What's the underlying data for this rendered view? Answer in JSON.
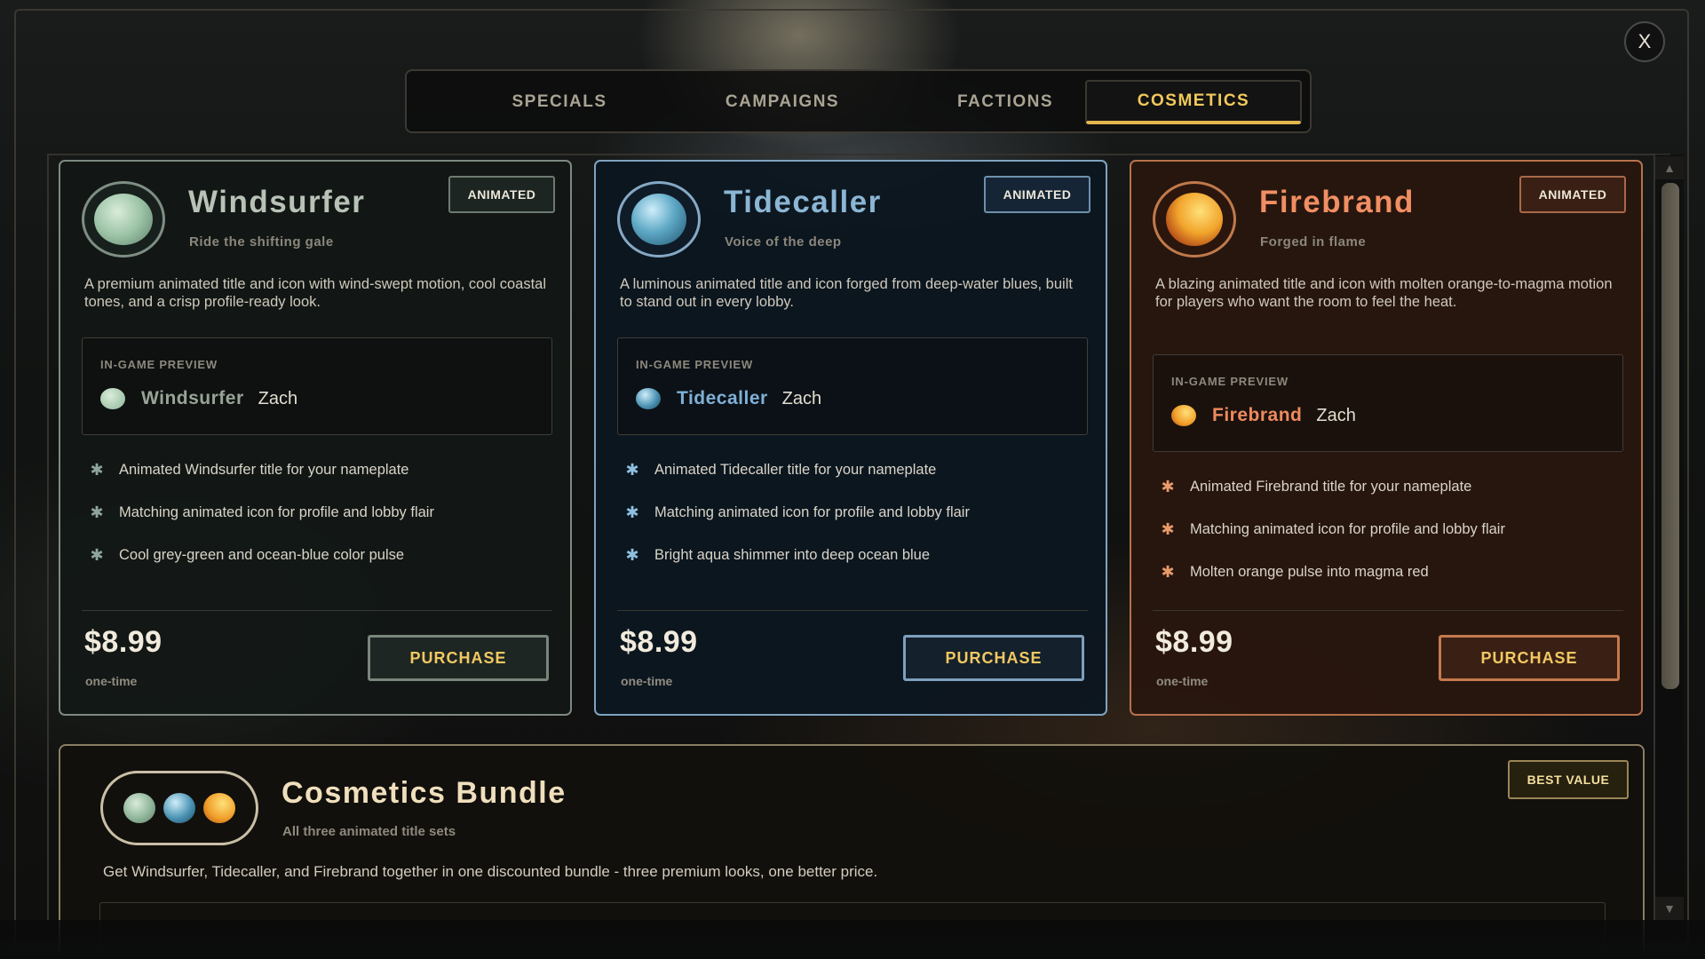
{
  "close_label": "X",
  "tabs": [
    {
      "label": "SPECIALS",
      "active": false
    },
    {
      "label": "CAMPAIGNS",
      "active": false
    },
    {
      "label": "FACTIONS",
      "active": false
    },
    {
      "label": "COSMETICS",
      "active": true
    }
  ],
  "cards": [
    {
      "title": "Windsurfer",
      "subtitle": "Ride the shifting gale",
      "badge": "ANIMATED",
      "description": "A premium animated title and icon with wind-swept motion, cool coastal tones, and a crisp profile-ready look.",
      "preview_label": "IN-GAME PREVIEW",
      "preview_title": "Windsurfer",
      "preview_name": "Zach",
      "features": [
        "Animated Windsurfer title for your nameplate",
        "Matching animated icon for profile and lobby flair",
        "Cool grey-green and ocean-blue color pulse"
      ],
      "price": "$8.99",
      "price_note": "one-time",
      "purchase_label": "PURCHASE",
      "icon": "jade-orb-icon",
      "accent": "#98a496"
    },
    {
      "title": "Tidecaller",
      "subtitle": "Voice of the deep",
      "badge": "ANIMATED",
      "description": "A luminous animated title and icon forged from deep-water blues, built to stand out in every lobby.",
      "preview_label": "IN-GAME PREVIEW",
      "preview_title": "Tidecaller",
      "preview_name": "Zach",
      "features": [
        "Animated Tidecaller title for your nameplate",
        "Matching animated icon for profile and lobby flair",
        "Bright aqua shimmer into deep ocean blue"
      ],
      "price": "$8.99",
      "price_note": "one-time",
      "purchase_label": "PURCHASE",
      "icon": "water-orb-icon",
      "accent": "#7fb0d6"
    },
    {
      "title": "Firebrand",
      "subtitle": "Forged in flame",
      "badge": "ANIMATED",
      "description": "A blazing animated title and icon with molten orange-to-magma motion for players who want the room to feel the heat.",
      "preview_label": "IN-GAME PREVIEW",
      "preview_title": "Firebrand",
      "preview_name": "Zach",
      "features": [
        "Animated Firebrand title for your nameplate",
        "Matching animated icon for profile and lobby flair",
        "Molten orange pulse into magma red"
      ],
      "price": "$8.99",
      "price_note": "one-time",
      "purchase_label": "PURCHASE",
      "icon": "flame-orb-icon",
      "accent": "#ee8a5e"
    }
  ],
  "bundle": {
    "title": "Cosmetics Bundle",
    "subtitle": "All three animated title sets",
    "badge": "BEST VALUE",
    "description": "Get Windsurfer, Tidecaller, and Firebrand together in one discounted bundle - three premium looks, one better price.",
    "icons": [
      "jade-orb-icon",
      "water-orb-icon",
      "flame-orb-icon"
    ]
  },
  "colors": {
    "gold_accent": "#f1c95c",
    "windsurfer": "#7d8a80",
    "tidecaller": "#7fa3c0",
    "firebrand": "#b8714a"
  }
}
